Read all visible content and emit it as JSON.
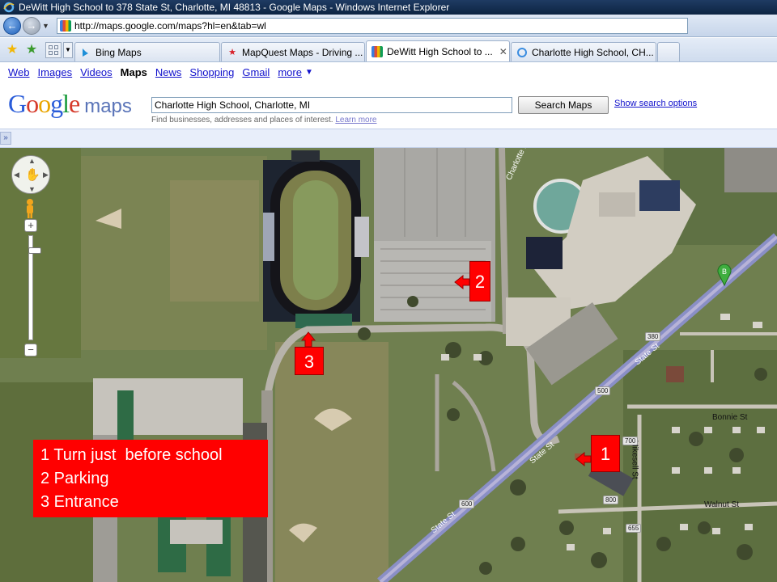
{
  "window": {
    "title": "DeWitt High School to 378 State St, Charlotte, MI 48813 - Google Maps - Windows Internet Explorer"
  },
  "address_bar": {
    "url": "http://maps.google.com/maps?hl=en&tab=wl"
  },
  "tabs": [
    {
      "label": "Bing Maps",
      "icon": "bing-icon"
    },
    {
      "label": "MapQuest Maps - Driving ...",
      "icon": "mapquest-star-icon"
    },
    {
      "label": "DeWitt High School to ...",
      "icon": "google-icon",
      "active": true
    },
    {
      "label": "Charlotte High School, CH...",
      "icon": "ie-page-icon"
    }
  ],
  "google_nav": {
    "items": [
      "Web",
      "Images",
      "Videos",
      "Maps",
      "News",
      "Shopping",
      "Gmail",
      "more"
    ],
    "current": "Maps"
  },
  "search": {
    "logo_google": "Google",
    "logo_maps": "maps",
    "query": "Charlotte High School, Charlotte, MI",
    "button": "Search Maps",
    "options_link": "Show search options",
    "hint": "Find businesses, addresses and places of interest.",
    "learn_more": "Learn more"
  },
  "panel": {
    "expand_label": "»"
  },
  "map": {
    "controls": {
      "zoom_in": "+",
      "zoom_out": "−"
    },
    "road_labels": {
      "state_st_1": "State St",
      "state_st_2": "State St",
      "state_st_3": "State St",
      "bonnie": "Bonnie St",
      "walnut": "Walnut St",
      "mikesell": "Mikesell St",
      "charlotte_hs": "Charlotte HS"
    },
    "shields": {
      "s380": "380",
      "s500": "500",
      "s600": "600",
      "s700": "700",
      "s800": "800",
      "s655": "655"
    },
    "marker_letter": "B",
    "annotations": {
      "n1": "1",
      "n2": "2",
      "n3": "3"
    },
    "legend": [
      "1 Turn just  before school",
      "2 Parking",
      "3 Entrance"
    ]
  },
  "colors": {
    "annotation_red": "#ff0000",
    "link_blue": "#1111cc",
    "title_bar": "#1f3b63"
  }
}
